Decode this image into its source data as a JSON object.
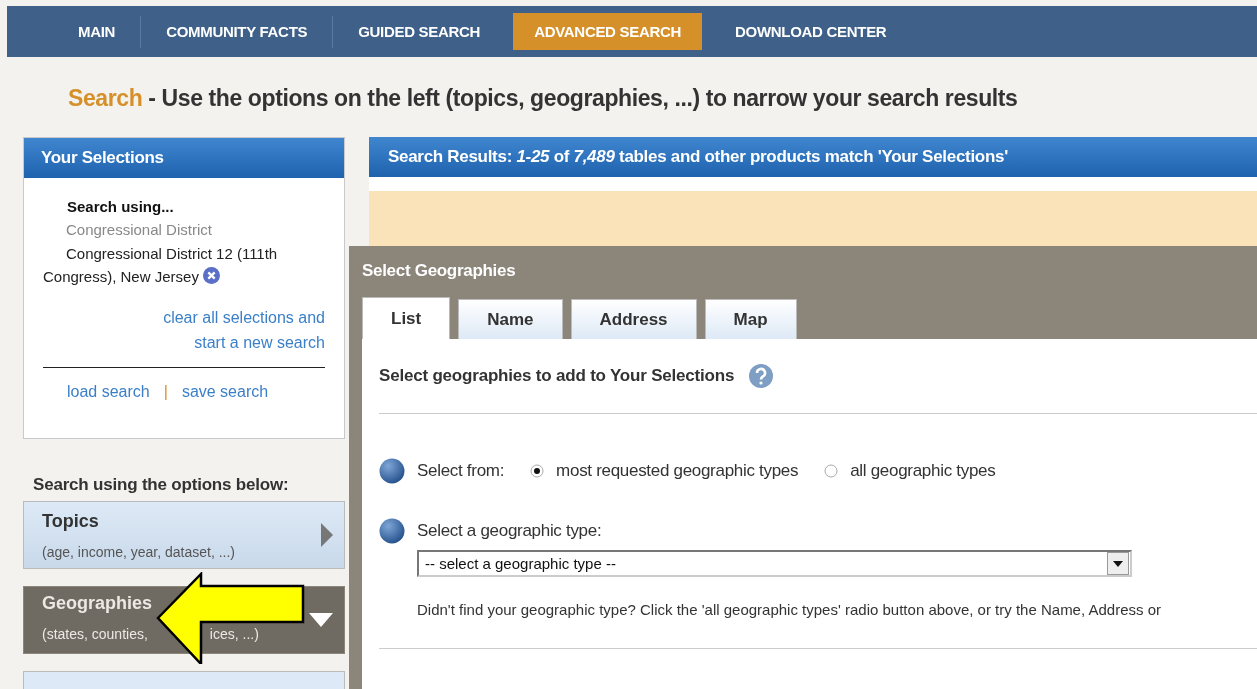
{
  "nav": {
    "items": [
      {
        "label": "MAIN",
        "selected": false
      },
      {
        "label": "COMMUNITY FACTS",
        "selected": false
      },
      {
        "label": "GUIDED SEARCH",
        "selected": false
      },
      {
        "label": "ADVANCED SEARCH",
        "selected": true
      },
      {
        "label": "DOWNLOAD CENTER",
        "selected": false
      }
    ]
  },
  "heading": {
    "keyword": "Search",
    "text": "- Use the options on the left (topics, geographies, ...) to narrow your search results"
  },
  "selections": {
    "title": "Your Selections",
    "label": "Search using...",
    "category": "Congressional District",
    "value": "Congressional District 12 (111th Congress), New Jersey",
    "clear_link": "clear all selections and start a new search",
    "load_link": "load search",
    "separator": "|",
    "save_link": "save search"
  },
  "options": {
    "label": "Search using the options below:",
    "items": [
      {
        "title": "Topics",
        "subtitle": "(age, income, year, dataset, ...)",
        "selected": false
      },
      {
        "title": "Geographies",
        "subtitle": "(states, counties,",
        "subtitle_rest": "ices, ...)",
        "selected": true
      }
    ]
  },
  "results": {
    "summary": "Search Results:  *1-25* of *7,489* tables and other products match 'Your Selections'"
  },
  "dialog": {
    "title": "Select Geographies",
    "tabs": [
      {
        "label": "List",
        "selected": true
      },
      {
        "label": "Name",
        "selected": false
      },
      {
        "label": "Address",
        "selected": false
      },
      {
        "label": "Map",
        "selected": false
      }
    ],
    "intro": "Select geographies to add to Your Selections",
    "select_from": {
      "label": "Select from:",
      "options": [
        {
          "label": "most requested geographic types",
          "selected": true
        },
        {
          "label": "all geographic types",
          "selected": false
        }
      ]
    },
    "type_label": "Select a geographic type:",
    "type_dropdown": {
      "value": "-- select a geographic type --"
    },
    "hint": "Didn't find your geographic type? Click the 'all geographic types' radio button above, or try the Name, Address or"
  }
}
